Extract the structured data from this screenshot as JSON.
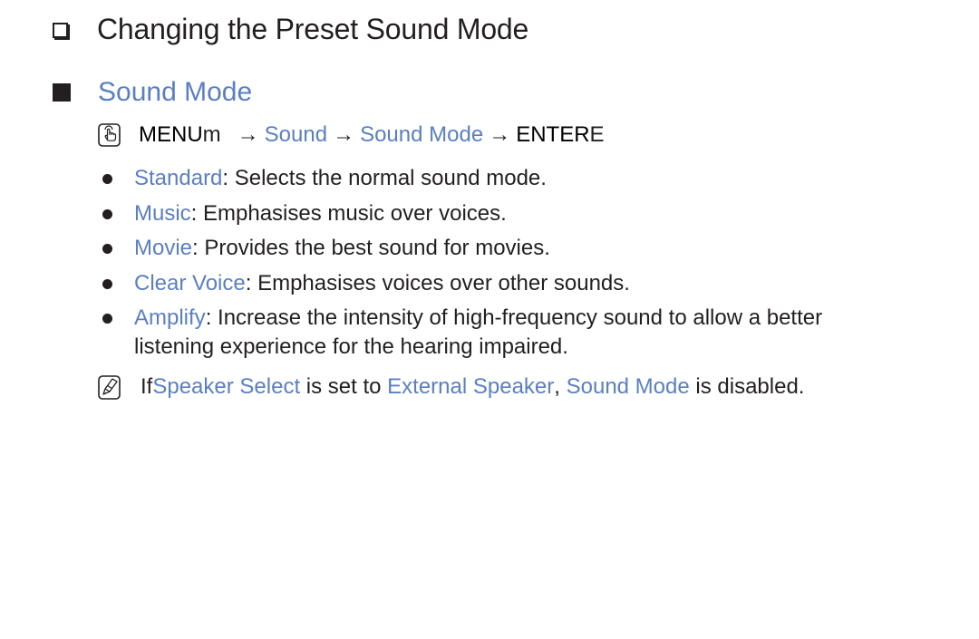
{
  "section_heading": {
    "icon": "checkbox-square-icon",
    "title": "Changing the Preset Sound Mode"
  },
  "subsection_heading": {
    "icon": "filled-square-icon",
    "title": "Sound Mode"
  },
  "menu_path": {
    "icon": "remote-hand-press-icon",
    "menu_label": "MENU",
    "menu_suffix": "m",
    "arrow": "→",
    "steps": [
      "Sound",
      "Sound Mode"
    ],
    "enter_label": "ENTER",
    "enter_suffix": "E"
  },
  "options": [
    {
      "name": "Standard",
      "description": ": Selects the normal sound mode."
    },
    {
      "name": "Music",
      "description": ": Emphasises music over voices."
    },
    {
      "name": "Movie",
      "description": ": Provides the best sound for movies."
    },
    {
      "name": "Clear Voice",
      "description": ": Emphasises voices over other sounds."
    },
    {
      "name": "Amplify",
      "description": ": Increase the intensity of high-frequency sound to allow a better listening experience for the hearing impaired."
    }
  ],
  "note": {
    "icon": "note-pencil-icon",
    "prefix": "If ",
    "term1": "Speaker Select",
    "mid1": " is set to ",
    "term2": "External Speaker",
    "mid2": ", ",
    "term3": "Sound Mode",
    "suffix": " is disabled."
  },
  "colors": {
    "text": "#231f20",
    "accent_blue": "#5b7fc3"
  }
}
